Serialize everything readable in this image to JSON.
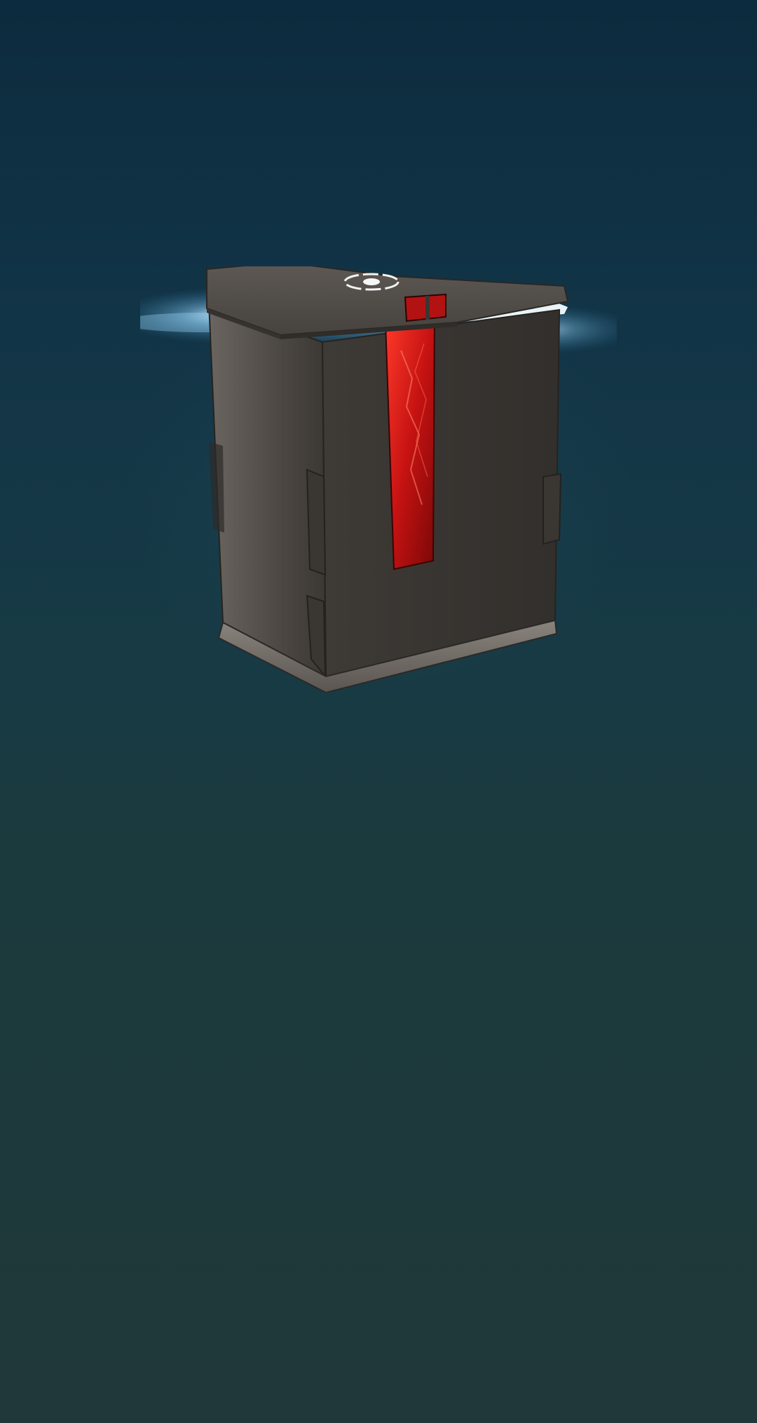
{
  "scene": {
    "name": "loot-chest-opening",
    "background_colors": [
      "#0c2b3e",
      "#173a45",
      "#203839"
    ],
    "chest": {
      "icon": "loot-box-icon",
      "state": "opening",
      "core_color": "#d01818",
      "metal_color": "#4a4541",
      "glow_color": "#bfe9ff"
    }
  }
}
